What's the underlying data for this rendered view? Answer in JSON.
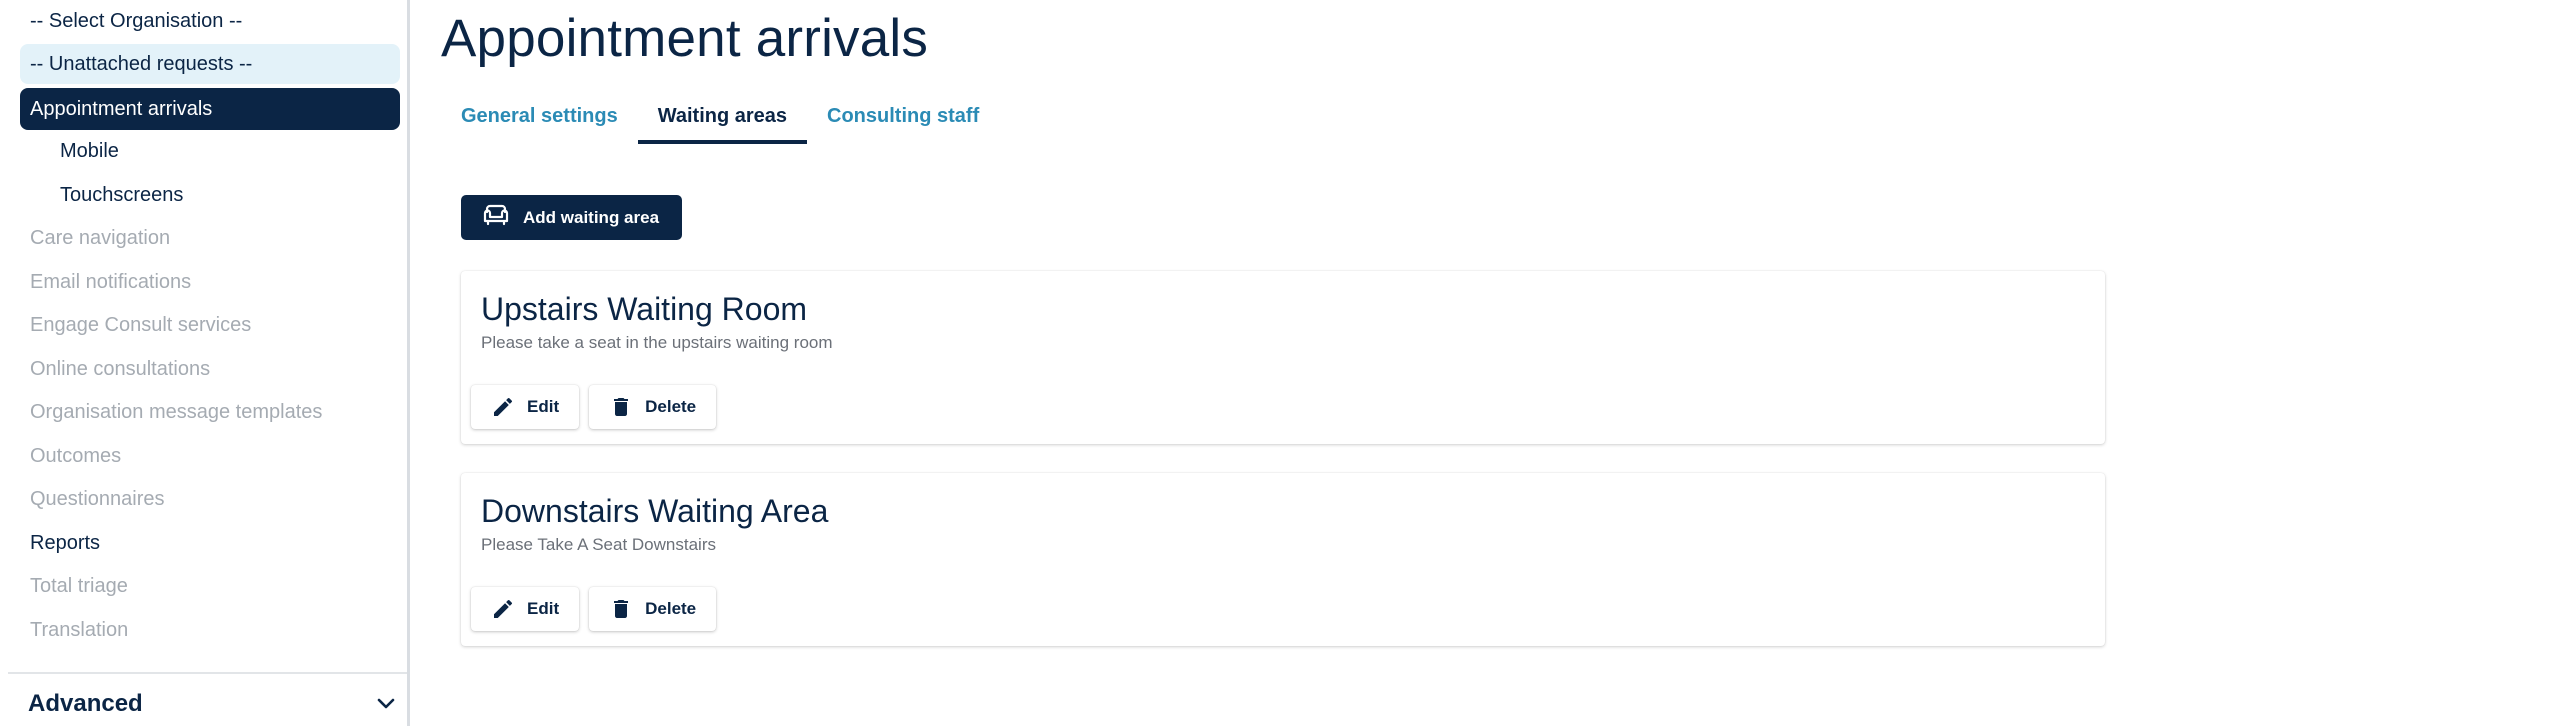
{
  "sidebar": {
    "items": [
      {
        "label": "-- Select Organisation --"
      },
      {
        "label": "-- Unattached requests --"
      },
      {
        "label": "Appointment arrivals"
      },
      {
        "label": "Mobile"
      },
      {
        "label": "Touchscreens"
      },
      {
        "label": "Care navigation"
      },
      {
        "label": "Email notifications"
      },
      {
        "label": "Engage Consult services"
      },
      {
        "label": "Online consultations"
      },
      {
        "label": "Organisation message templates"
      },
      {
        "label": "Outcomes"
      },
      {
        "label": "Questionnaires"
      },
      {
        "label": "Reports"
      },
      {
        "label": "Total triage"
      },
      {
        "label": "Translation"
      }
    ],
    "advanced_label": "Advanced"
  },
  "main": {
    "title": "Appointment arrivals",
    "tabs": [
      {
        "label": "General settings"
      },
      {
        "label": "Waiting areas"
      },
      {
        "label": "Consulting staff"
      }
    ],
    "add_button_label": "Add waiting area",
    "waiting_areas": [
      {
        "name": "Upstairs Waiting Room",
        "description": "Please take a seat in the upstairs waiting room",
        "edit_label": "Edit",
        "delete_label": "Delete"
      },
      {
        "name": "Downstairs Waiting Area",
        "description": "Please Take A Seat Downstairs",
        "edit_label": "Edit",
        "delete_label": "Delete"
      }
    ]
  },
  "colors": {
    "primary": "#0b2545",
    "link": "#2b8bb5",
    "highlight_bg": "#e3f2f9",
    "disabled_text": "#a5abb2"
  },
  "icons": {
    "add_button": "sofa-icon",
    "edit": "pencil-icon",
    "delete": "trash-icon",
    "advanced": "chevron-down-icon"
  }
}
